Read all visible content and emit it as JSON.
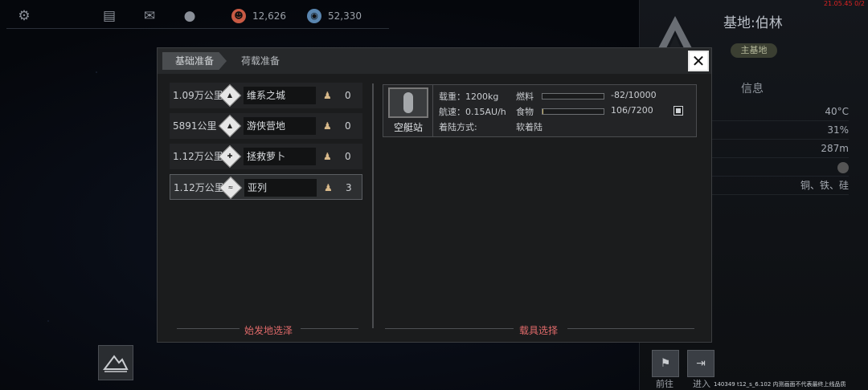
{
  "topbar": {
    "resource1": "12,626",
    "resource2": "52,330"
  },
  "right_panel": {
    "build_id": "21.05.45 0/2",
    "base_title": "基地:伯林",
    "main_badge": "主基地",
    "info_heading": "信息",
    "info_rows": [
      "40°C",
      "31%",
      "287m",
      "",
      "铜、铁、硅"
    ],
    "go_label": "前往",
    "enter_label": "进入",
    "footnote": "140349 t12_s_6.102 内测画面不代表最终上线品质"
  },
  "dialog": {
    "tabs": [
      "基础准备",
      "荷载准备"
    ],
    "close_label": "✕",
    "destinations": [
      {
        "distance": "1.09万公里",
        "name": "维系之城",
        "count": "0",
        "selected": false
      },
      {
        "distance": "5891公里",
        "name": "游侠营地",
        "count": "0",
        "selected": false
      },
      {
        "distance": "1.12万公里",
        "name": "拯救萝卜",
        "count": "0",
        "selected": false
      },
      {
        "distance": "1.12万公里",
        "name": "亚列",
        "count": "3",
        "selected": true
      }
    ],
    "left_section_label": "始发地选泽",
    "right_section_label": "载具选择",
    "vehicle": {
      "name": "空艇站",
      "load_label": "载重：1200kg",
      "speed_label": "航速：0.15AU/h",
      "landing_label": "着陆方式:",
      "landing_value": "软着陆",
      "fuel_label": "燃料",
      "fuel_value": "-82/10000",
      "fuel_fill": 0,
      "food_label": "食物",
      "food_value": "106/7200",
      "food_fill": 0.015
    }
  },
  "colors": {
    "accent_red": "#e06a6a",
    "bar_fill": "#c9b36a"
  }
}
